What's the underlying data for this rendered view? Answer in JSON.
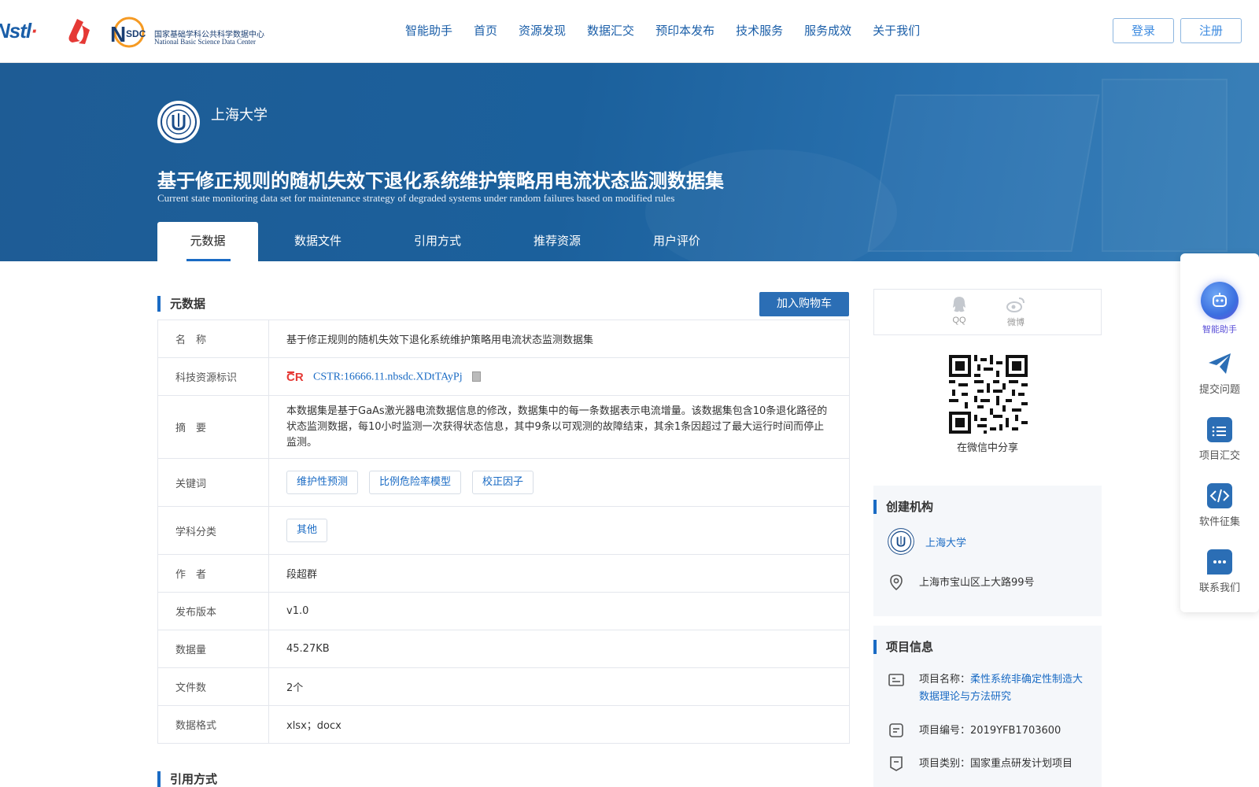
{
  "header": {
    "logos": [
      "NSTL",
      "nstl-red-logo",
      "NSDC"
    ],
    "nsdc_cn": "国家基础学科公共科学数据中心",
    "nsdc_en": "National Basic Science Data Center",
    "nav": [
      "智能助手",
      "首页",
      "资源发现",
      "数据汇交",
      "预印本发布",
      "技术服务",
      "服务成效",
      "关于我们"
    ],
    "login_label": "登录",
    "register_label": "注册"
  },
  "hero": {
    "institution": "上海大学",
    "title_cn": "基于修正规则的随机失效下退化系统维护策略用电流状态监测数据集",
    "title_en": "Current state monitoring data set for maintenance strategy of degraded systems under random failures based on modified rules",
    "tabs": [
      "元数据",
      "数据文件",
      "引用方式",
      "推荐资源",
      "用户评价"
    ],
    "active_tab": "元数据"
  },
  "metadata_section": {
    "heading": "元数据",
    "cart_button": "加入购物车",
    "rows": {
      "name": {
        "label": "名　称",
        "value": "基于修正规则的随机失效下退化系统维护策略用电流状态监测数据集"
      },
      "cstr": {
        "label": "科技资源标识",
        "value": "CSTR:16666.11.nbsdc.XDtTAyPj"
      },
      "abstract": {
        "label": "摘　要",
        "value": "本数据集是基于GaAs激光器电流数据信息的修改，数据集中的每一条数据表示电流增量。该数据集包含10条退化路径的状态监测数据，每10小时监测一次获得状态信息，其中9条以可观测的故障结束，其余1条因超过了最大运行时间而停止监测。"
      },
      "keywords": {
        "label": "关键词",
        "tags": [
          "维护性预测",
          "比例危险率模型",
          "校正因子"
        ]
      },
      "discipline": {
        "label": "学科分类",
        "tags": [
          "其他"
        ]
      },
      "author": {
        "label": "作　者",
        "value": "段超群"
      },
      "version": {
        "label": "发布版本",
        "value": "v1.0"
      },
      "size": {
        "label": "数据量",
        "value": "45.27KB"
      },
      "file_count": {
        "label": "文件数",
        "value": "2个"
      },
      "format": {
        "label": "数据格式",
        "value": "xlsx；docx"
      }
    }
  },
  "citation_section": {
    "heading": "引用方式"
  },
  "share": {
    "qq_label": "QQ",
    "weibo_label": "微博",
    "qr_caption": "在微信中分享"
  },
  "creator_panel": {
    "heading": "创建机构",
    "institution": "上海大学",
    "address": "上海市宝山区上大路99号"
  },
  "project_panel": {
    "heading": "项目信息",
    "name_label": "项目名称：",
    "name_value": "柔性系统非确定性制造大数据理论与方法研究",
    "number": "项目编号：2019YFB1703600",
    "category": "项目类别：国家重点研发计划项目"
  },
  "side_toolbar": {
    "items": [
      "智能助手",
      "提交问题",
      "项目汇交",
      "软件征集",
      "联系我们"
    ]
  },
  "colors": {
    "primary": "#1a6bc4",
    "hero_bg": "#1e5c95",
    "cart_button": "#2b6eb5"
  }
}
